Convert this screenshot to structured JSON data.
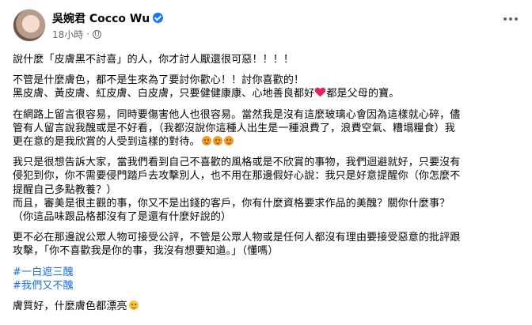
{
  "author": {
    "name": "吳婉君 Cocco Wu",
    "time": "18小時",
    "separator": "·"
  },
  "post": {
    "p1": [
      "說什麼「皮膚黑不討喜」的人，你才討人厭還很可惡！！！！"
    ],
    "p2": [
      "不管是什麼膚色，都不是生來為了要討你歡心！！討你喜歡的！",
      "黑皮膚、黃皮膚、紅皮膚、白皮膚，只要健健康康、心地善良都好",
      "都是父母的寶。"
    ],
    "p3": [
      "在網路上留言很容易，同時要傷害他人也很容易。當然我是沒有這麼玻璃心會因為這樣就心碎，儘",
      "管有人留言說我醜或是不好看，（我都沒說你這種人出生是一種浪費了，浪費空氣、糟塌糧食）我",
      "更在意的是我欣賞的人受到這樣的對待。"
    ],
    "p4": [
      "我只是很想告訴大家，當我們看到自己不喜歡的風格或是不欣賞的事物，我們迴避就好，只要沒有",
      "侵犯到你，你不需要侵門踏戶去攻擊別人，也不用在那邊假好心說：我只是好意提醒你（你怎麼不",
      "提醒自己多點教養？）",
      "而且，審美是很主觀的事，你又不是出錢的客戶，你有什麼資格要求作品的美醜？關你什麼事？",
      "（你這品味跟品格都沒有了是還有什麼好說的）"
    ],
    "p5": [
      "更不必在那邊說公眾人物可接受公評，不管是公眾人物或是任何人都沒有理由要接受惡意的批評跟",
      "攻擊，「你不喜歡我是你的事，我沒有想要知道。」（懂嗎）"
    ],
    "hashtags": [
      "#一白遮三醜",
      "#我們又不醜"
    ],
    "p6": [
      "膚質好，什麼膚色都漂亮"
    ]
  },
  "icons": {
    "heart": "red-heart-icon",
    "angry": "face-with-steam-icon",
    "smile": "smiling-face-icon"
  }
}
